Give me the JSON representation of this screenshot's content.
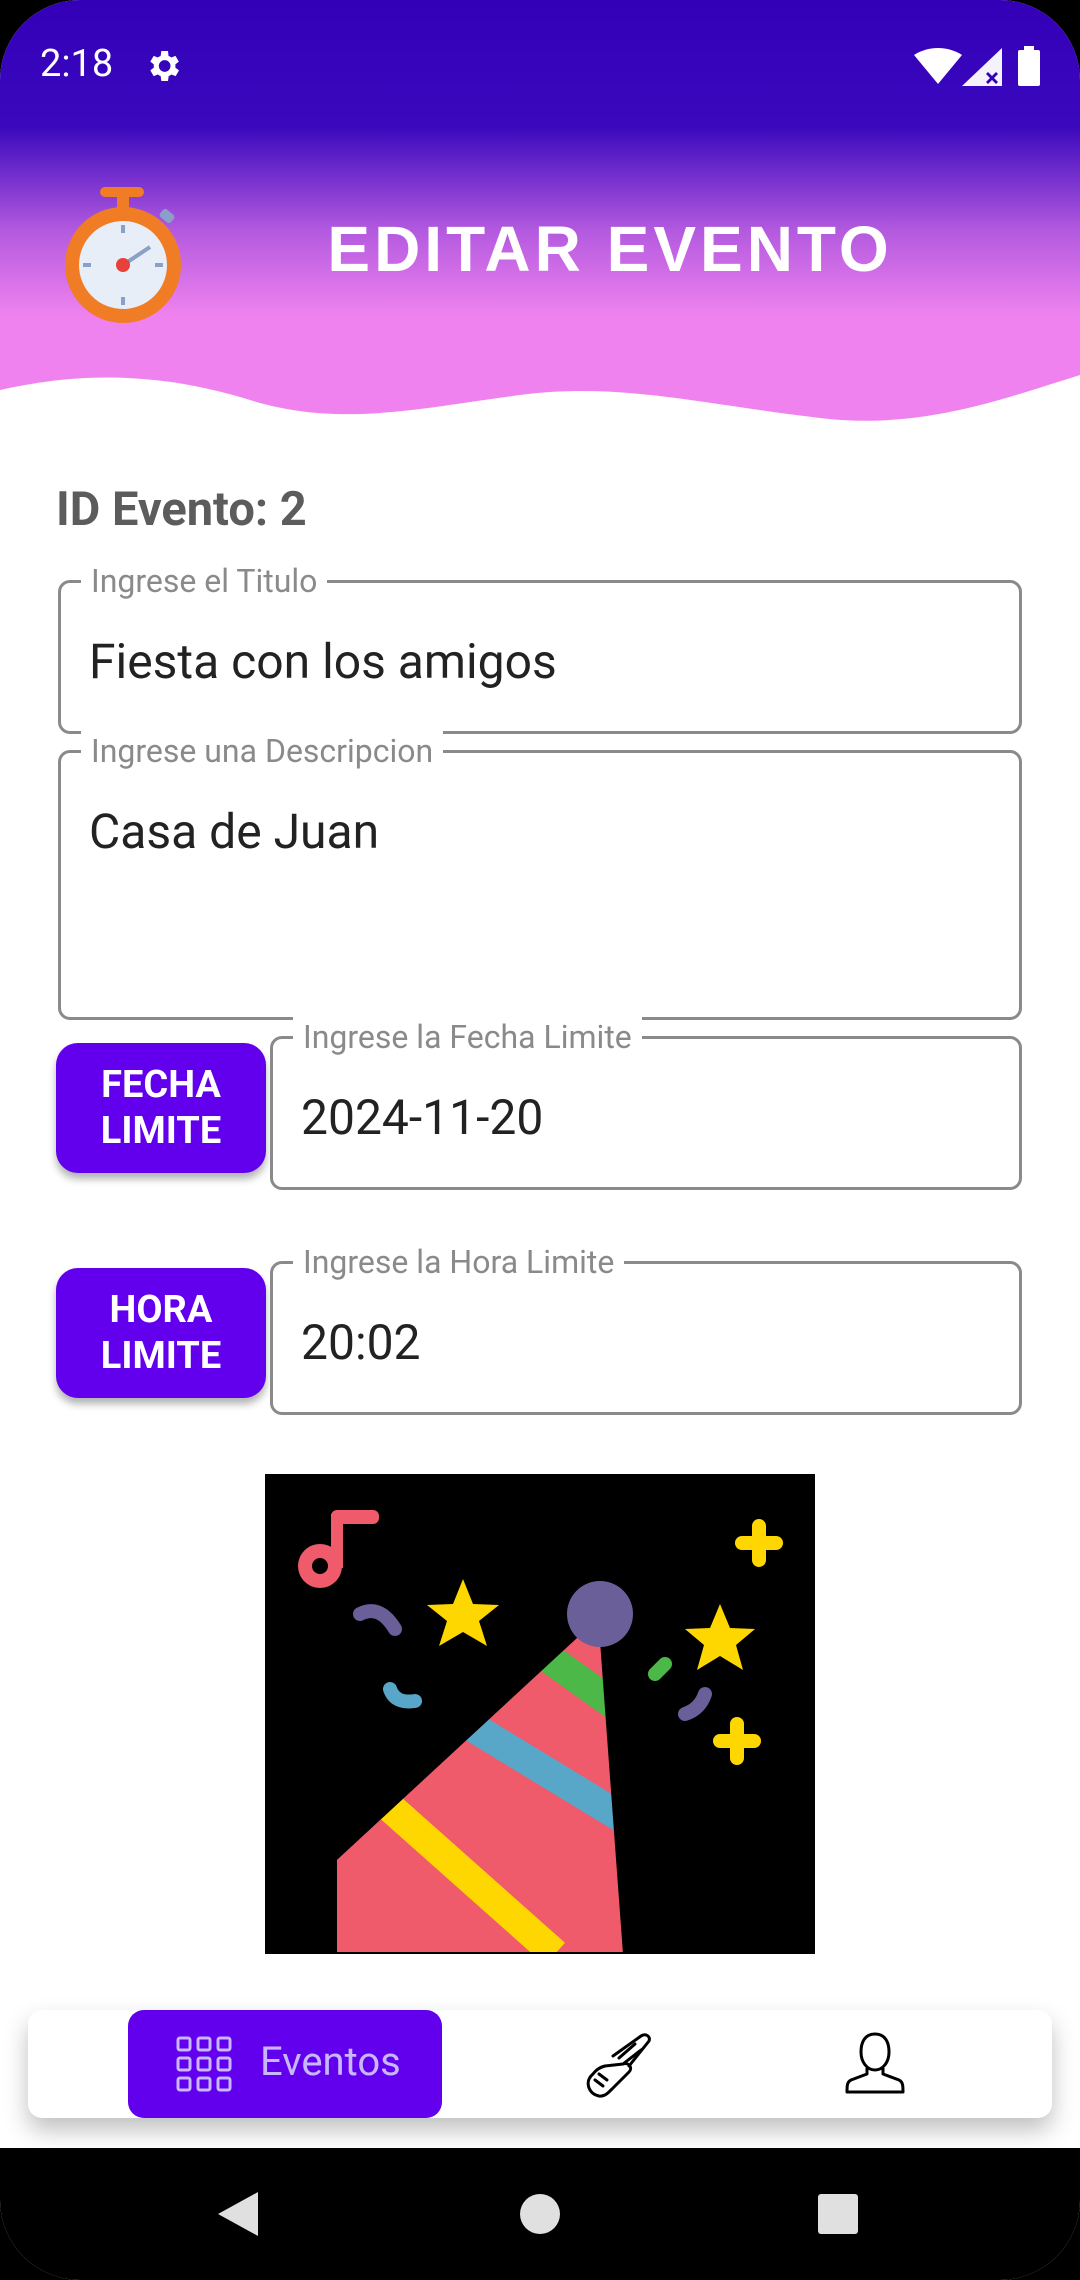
{
  "status_bar": {
    "time": "2:18"
  },
  "header": {
    "title": "EDITAR EVENTO",
    "gradient_top": "#3300b8",
    "gradient_bottom": "#ef82ef"
  },
  "form": {
    "event_id_label": "ID Evento: 2",
    "title_field": {
      "label": "Ingrese el Titulo",
      "value": "Fiesta con los amigos"
    },
    "description_field": {
      "label": "Ingrese una Descripcion",
      "value": "Casa de Juan"
    },
    "date_button": {
      "line1": "FECHA",
      "line2": "LIMITE"
    },
    "date_field": {
      "label": "Ingrese la Fecha Limite",
      "value": "2024-11-20"
    },
    "time_button": {
      "line1": "HORA",
      "line2": "LIMITE"
    },
    "time_field": {
      "label": "Ingrese la Hora Limite",
      "value": "20:02"
    },
    "image_icon": "party-hat-icon"
  },
  "bottom_nav": {
    "items": [
      {
        "label": "Eventos",
        "icon": "grid-icon",
        "active": true
      },
      {
        "icon": "tools-icon"
      },
      {
        "icon": "profile-icon"
      }
    ],
    "accent": "#6200ee"
  }
}
